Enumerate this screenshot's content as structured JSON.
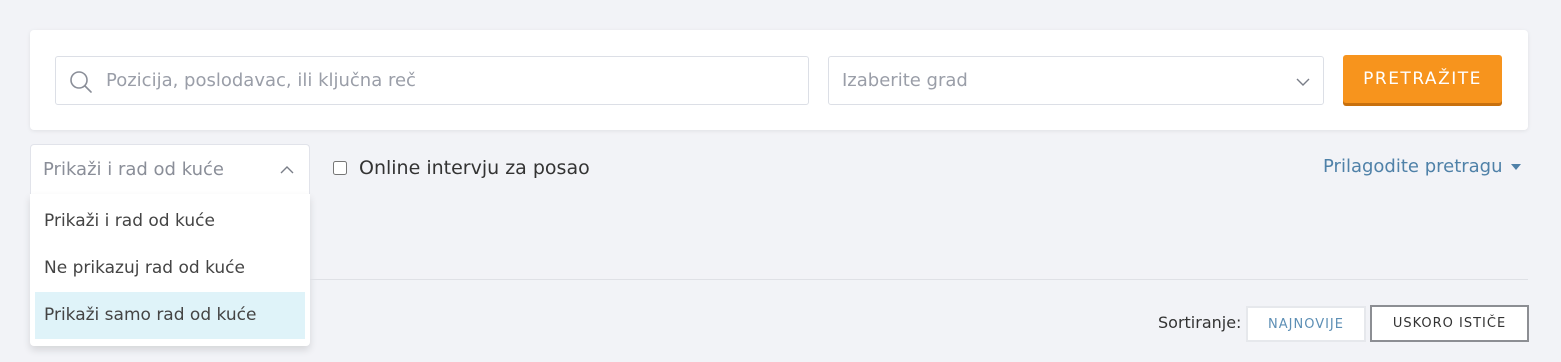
{
  "search": {
    "keyword_placeholder": "Pozicija, poslodavac, ili ključna reč",
    "keyword_value": "",
    "city_placeholder": "Izaberite grad",
    "submit_label": "PRETRAŽITE"
  },
  "remote_filter": {
    "selected": "Prikaži i rad od kuće",
    "options": [
      "Prikaži i rad od kuće",
      "Ne prikazuj rad od kuće",
      "Prikaži samo rad od kuće"
    ],
    "highlighted_option": "Prikaži samo rad od kuće"
  },
  "online_interview": {
    "label": "Online intervju za posao",
    "checked": false
  },
  "customize": {
    "label": "Prilagodite pretragu",
    "icon": "caret-down-icon"
  },
  "sorting": {
    "label": "Sortiranje:",
    "newest": "NAJNOVIJE",
    "expiring": "USKORO ISTIČE"
  },
  "colors": {
    "accent": "#f7941d",
    "link": "#4f81a8",
    "highlight": "#dff3f9",
    "background": "#f2f3f7"
  }
}
